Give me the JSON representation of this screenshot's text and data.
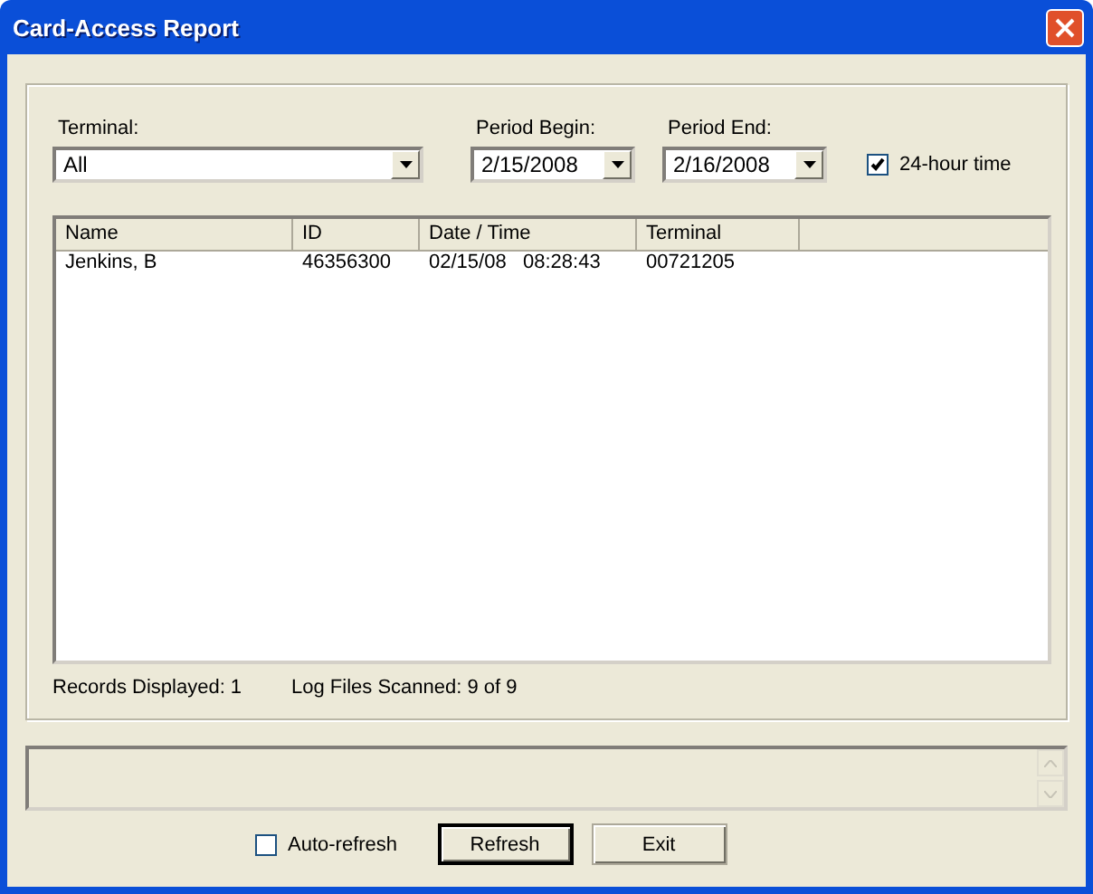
{
  "window": {
    "title": "Card-Access Report"
  },
  "filters": {
    "terminal": {
      "label": "Terminal:",
      "value": "All"
    },
    "period_begin": {
      "label": "Period Begin:",
      "value": "2/15/2008"
    },
    "period_end": {
      "label": "Period End:",
      "value": "2/16/2008"
    },
    "hour24": {
      "label": "24-hour time",
      "checked": true
    }
  },
  "table": {
    "columns": [
      "Name",
      "ID",
      "Date / Time",
      "Terminal"
    ],
    "rows": [
      [
        "Jenkins, B",
        "46356300",
        "02/15/08   08:28:43",
        "00721205"
      ]
    ]
  },
  "status": {
    "records": "Records Displayed: 1",
    "files": "Log Files Scanned: 9 of 9"
  },
  "auto_refresh": {
    "label": "Auto-refresh",
    "checked": false
  },
  "buttons": [
    {
      "label": "Refresh",
      "default": true
    },
    {
      "label": "Exit",
      "default": false
    }
  ]
}
